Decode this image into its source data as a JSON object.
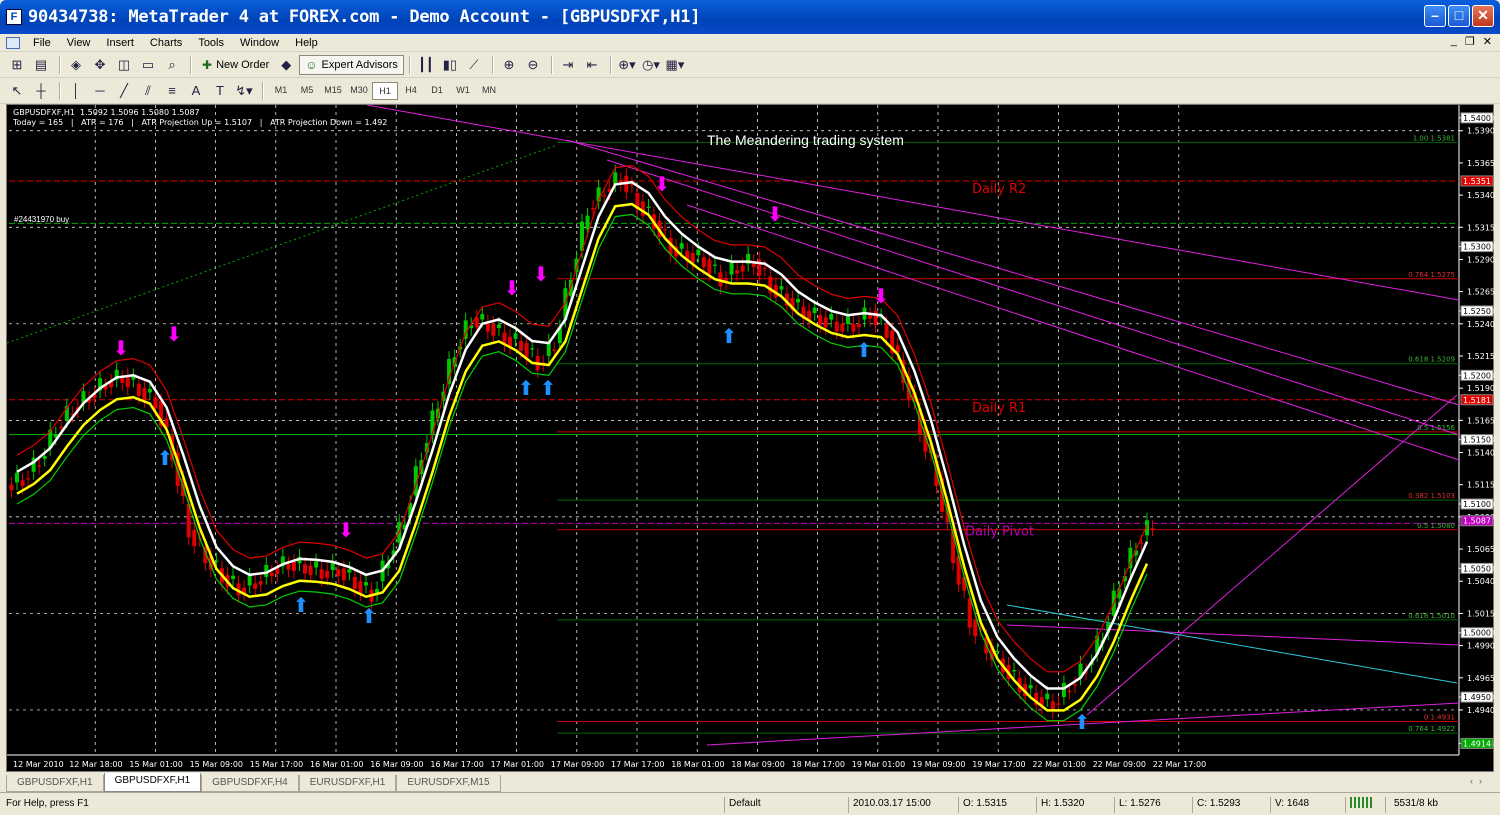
{
  "window": {
    "title": "90434738: MetaTrader 4 at FOREX.com - Demo Account - [GBPUSDFXF,H1]"
  },
  "menu": [
    "File",
    "View",
    "Insert",
    "Charts",
    "Tools",
    "Window",
    "Help"
  ],
  "toolbar": {
    "new_order": "New Order",
    "expert_advisors": "Expert Advisors"
  },
  "timeframes": [
    "M1",
    "M5",
    "M15",
    "M30",
    "H1",
    "H4",
    "D1",
    "W1",
    "MN"
  ],
  "active_timeframe": "H1",
  "chart": {
    "info_line1": "GBPUSDFXF,H1  1.5092 1.5096 1.5080 1.5087",
    "info_line2": "Today = 165   |   ATR = 176   |   ATR Projection Up = 1.5107   |   ATR Projection Down = 1.492",
    "heading": "The Meandering trading system",
    "order_label": "#24431970 buy",
    "levels": {
      "r2": "Daily R2",
      "r1": "Daily R1",
      "pivot": "Daily Pivot"
    },
    "fibo": [
      "1.00 1.5381",
      "0.764 1.5275",
      "0.618 1.5209",
      "0.5 1.5156",
      "0.382 1.5103",
      "0.5 1.5080",
      "0.618 1.5010",
      "0 1.4931",
      "0.764 1.4922"
    ]
  },
  "chart_data": {
    "type": "candlestick",
    "symbol": "GBPUSDFXF",
    "timeframe": "H1",
    "y_ticks": [
      "1.5400",
      "1.5390",
      "1.5365",
      "1.5340",
      "1.5315",
      "1.5300",
      "1.5290",
      "1.5265",
      "1.5250",
      "1.5240",
      "1.5215",
      "1.5200",
      "1.5190",
      "1.5165",
      "1.5150",
      "1.5140",
      "1.5115",
      "1.5100",
      "1.5090",
      "1.5065",
      "1.5050",
      "1.5040",
      "1.5015",
      "1.5000",
      "1.4990",
      "1.4965",
      "1.4950",
      "1.4940",
      "1.4914"
    ],
    "x_ticks": [
      "12 Mar 2010",
      "12 Mar 18:00",
      "15 Mar 01:00",
      "15 Mar 09:00",
      "15 Mar 17:00",
      "16 Mar 01:00",
      "16 Mar 09:00",
      "16 Mar 17:00",
      "17 Mar 01:00",
      "17 Mar 09:00",
      "17 Mar 17:00",
      "18 Mar 01:00",
      "18 Mar 09:00",
      "18 Mar 17:00",
      "19 Mar 01:00",
      "19 Mar 09:00",
      "19 Mar 17:00",
      "22 Mar 01:00",
      "22 Mar 09:00",
      "22 Mar 17:00"
    ],
    "ylim": [
      1.4905,
      1.541
    ],
    "close_path": [
      1.512,
      1.5135,
      1.516,
      1.5175,
      1.5185,
      1.5195,
      1.52,
      1.519,
      1.518,
      1.514,
      1.508,
      1.506,
      1.5045,
      1.5035,
      1.504,
      1.505,
      1.5055,
      1.5052,
      1.5048,
      1.505,
      1.504,
      1.503,
      1.506,
      1.509,
      1.514,
      1.518,
      1.522,
      1.5245,
      1.524,
      1.523,
      1.5225,
      1.521,
      1.5225,
      1.528,
      1.533,
      1.5345,
      1.5355,
      1.5335,
      1.532,
      1.53,
      1.5295,
      1.529,
      1.5275,
      1.5285,
      1.529,
      1.527,
      1.526,
      1.525,
      1.5245,
      1.524,
      1.524,
      1.525,
      1.5235,
      1.52,
      1.516,
      1.512,
      1.506,
      1.501,
      1.499,
      1.4975,
      1.496,
      1.495,
      1.4945,
      1.496,
      1.4975,
      1.5,
      1.504,
      1.507,
      1.5087
    ],
    "current_price": "1.5087"
  },
  "price_labels": {
    "high": "1.5400",
    "p1": "1.5351",
    "p2": "1.5300",
    "p3": "1.5250",
    "p4": "1.5200",
    "p5": "1.5181",
    "p6": "1.5150",
    "p7": "1.5100",
    "p8": "1.5087",
    "p9": "1.5050",
    "p10": "1.5000",
    "p11": "1.4950",
    "p12": "1.4914"
  },
  "tabs": [
    "GBPUSDFXF,H1",
    "GBPUSDFXF,H1",
    "GBPUSDFXF,H4",
    "EURUSDFXF,H1",
    "EURUSDFXF,M15"
  ],
  "active_tab": 1,
  "status": {
    "help": "For Help, press F1",
    "profile": "Default",
    "datetime": "2010.03.17 15:00",
    "open": "O: 1.5315",
    "high": "H: 1.5320",
    "low": "L: 1.5276",
    "close": "C: 1.5293",
    "volume": "V: 1648",
    "traffic": "5531/8 kb"
  },
  "colors": {
    "up": "#00c800",
    "down": "#e00000",
    "ma_white": "#ffffff",
    "ma_yellow": "#ffff00",
    "signal": "#ff00ff",
    "arrow_up": "#1e90ff"
  }
}
